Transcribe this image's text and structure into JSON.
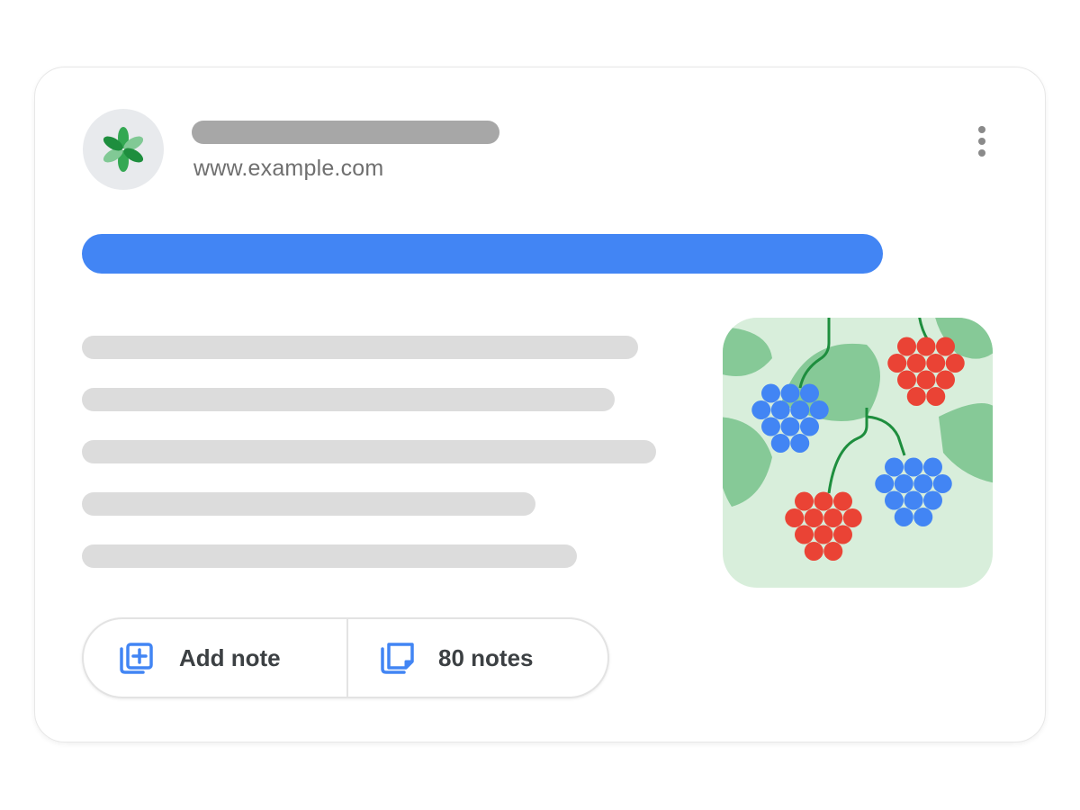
{
  "result": {
    "site_url": "www.example.com",
    "favicon_icon": "leaf-flower-icon",
    "more_icon": "more-vert-icon",
    "headline_color": "#4285f4",
    "thumbnail_icon": "berries-illustration"
  },
  "notes": {
    "add_label": "Add note",
    "add_icon": "add-note-icon",
    "count_label": "80 notes",
    "count_icon": "notes-stack-icon"
  },
  "colors": {
    "accent_blue": "#4285f4",
    "berry_red": "#ea4335",
    "leaf_green": "#34a853",
    "thumbnail_bg": "#d8eedb"
  }
}
